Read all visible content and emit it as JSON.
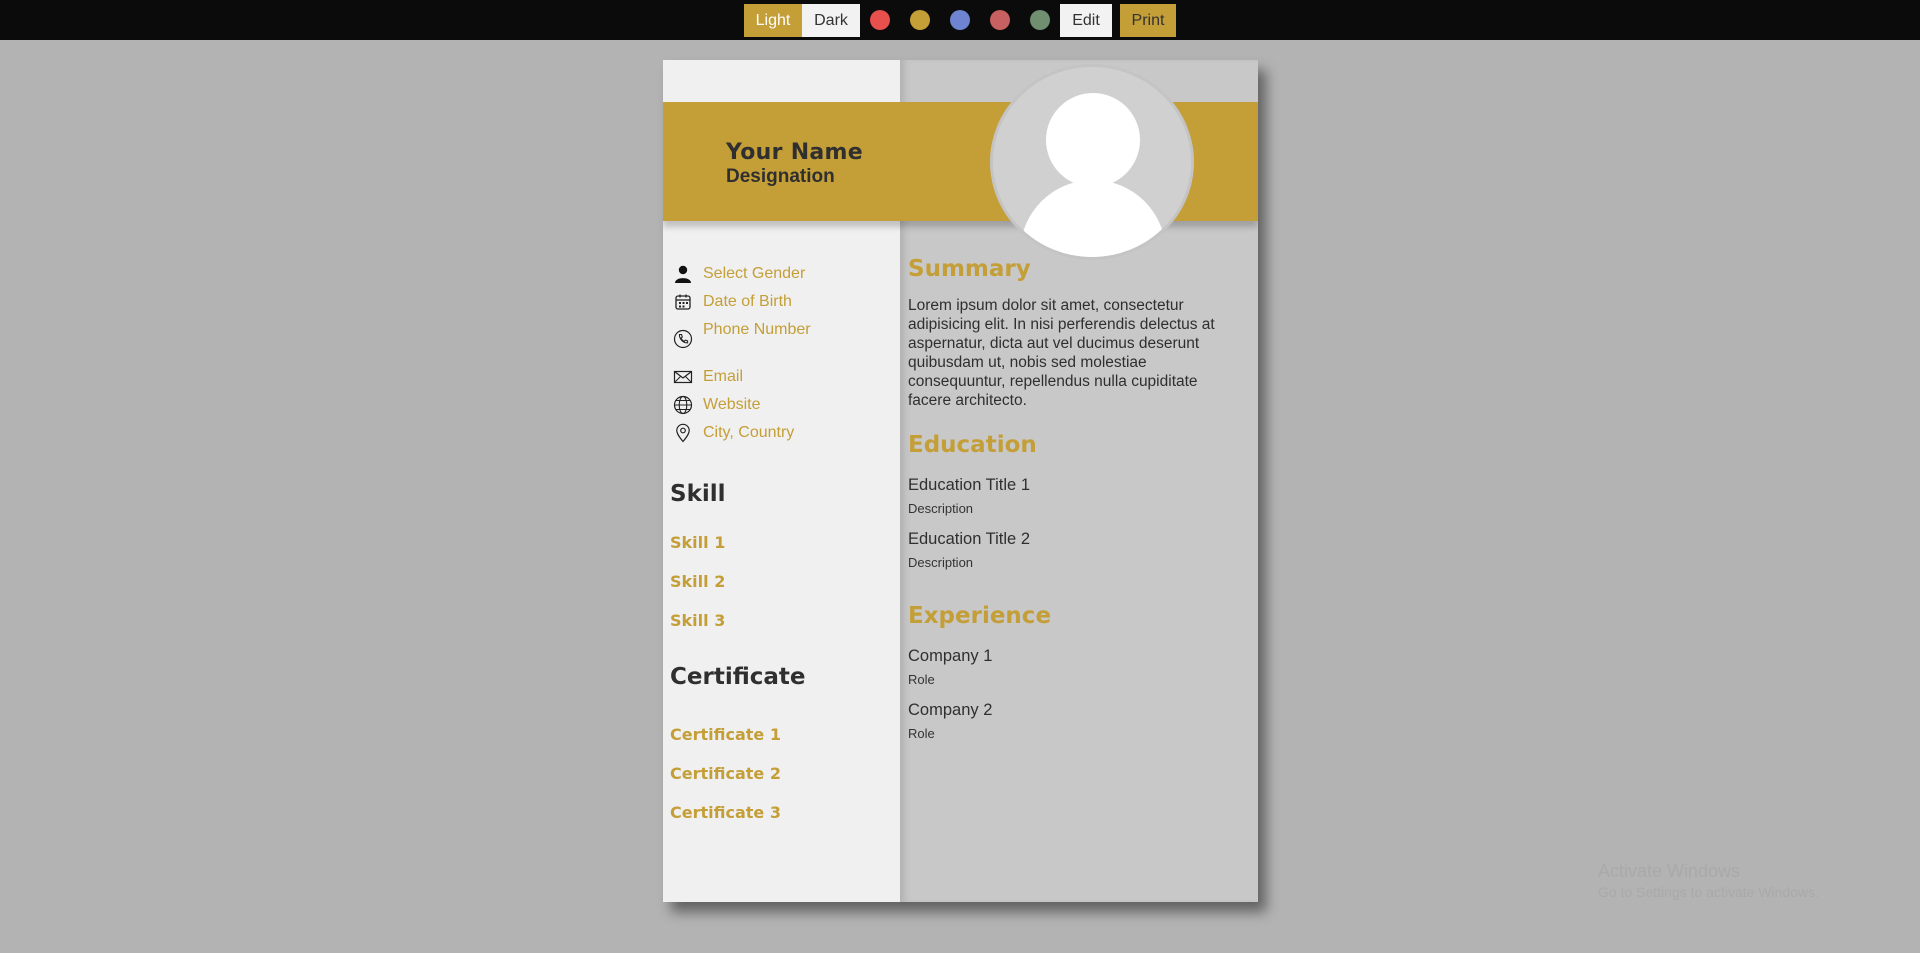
{
  "toolbar": {
    "light_label": "Light",
    "dark_label": "Dark",
    "edit_label": "Edit",
    "print_label": "Print",
    "swatches": [
      "#e8504e",
      "#c49e37",
      "#6f84d0",
      "#c76060",
      "#6f8f70"
    ]
  },
  "colors": {
    "accent": "#c49e37",
    "background": "#b3b3b3",
    "left_column": "#f0f0f0",
    "right_column": "#c8c8c8",
    "text": "#2f2f2f"
  },
  "resume": {
    "name": "Your Name",
    "designation": "Designation",
    "contacts": [
      {
        "icon": "person-icon",
        "label": "Select Gender"
      },
      {
        "icon": "calendar-icon",
        "label": "Date of Birth"
      },
      {
        "icon": "phone-icon",
        "label": "Phone Number"
      },
      {
        "icon": "mail-icon",
        "label": "Email"
      },
      {
        "icon": "globe-icon",
        "label": "Website"
      },
      {
        "icon": "location-pin-icon",
        "label": "City, Country"
      }
    ],
    "skill_heading": "Skill",
    "skills": [
      "Skill 1",
      "Skill 2",
      "Skill 3"
    ],
    "certificate_heading": "Certificate",
    "certificates": [
      "Certificate 1",
      "Certificate 2",
      "Certificate 3"
    ],
    "summary_heading": "Summary",
    "summary_text": "Lorem ipsum dolor sit amet, consectetur adipisicing elit. In nisi perferendis delectus at aspernatur, dicta aut vel ducimus deserunt quibusdam ut, nobis sed molestiae consequuntur, repellendus nulla cupiditate facere architecto.",
    "education_heading": "Education",
    "education": [
      {
        "title": "Education Title 1",
        "description": "Description"
      },
      {
        "title": "Education Title 2",
        "description": "Description"
      }
    ],
    "experience_heading": "Experience",
    "experience": [
      {
        "company": "Company 1",
        "role": "Role"
      },
      {
        "company": "Company 2",
        "role": "Role"
      }
    ]
  },
  "watermark": {
    "line1": "Activate Windows",
    "line2": "Go to Settings to activate Windows."
  }
}
